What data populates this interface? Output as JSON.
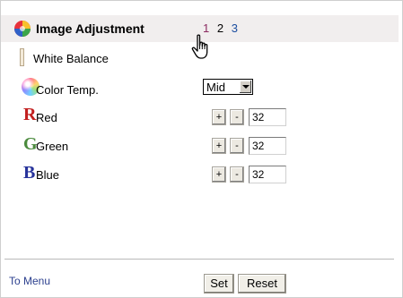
{
  "header": {
    "title": "Image Adjustment",
    "pages": [
      "1",
      "2",
      "3"
    ]
  },
  "white_balance": {
    "label": "White Balance",
    "color_temp": {
      "label": "Color Temp.",
      "value": "Mid"
    },
    "channels": [
      {
        "letter": "R",
        "label": "Red",
        "value": "32",
        "plus": "+",
        "minus": "-"
      },
      {
        "letter": "G",
        "label": "Green",
        "value": "32",
        "plus": "+",
        "minus": "-"
      },
      {
        "letter": "B",
        "label": "Blue",
        "value": "32",
        "plus": "+",
        "minus": "-"
      }
    ]
  },
  "footer": {
    "menu_link": "To Menu",
    "set_label": "Set",
    "reset_label": "Reset"
  },
  "colors": {
    "header_bg": "#f1eeee",
    "red": "#c21f1f",
    "green": "#4a8a3c",
    "blue": "#27339b",
    "link": "#2b3f8e"
  }
}
